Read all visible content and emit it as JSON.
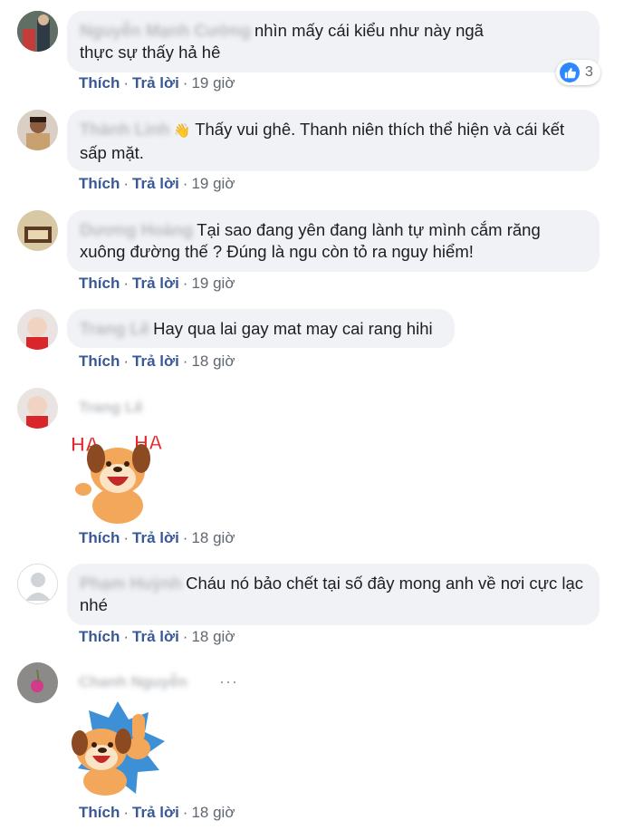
{
  "actions": {
    "like": "Thích",
    "reply": "Trả lời",
    "dot": "·"
  },
  "comments": [
    {
      "author": "Nguyễn Mạnh Cường",
      "text_line1": "nhìn mấy cái kiểu như này ngã",
      "text_line2": "thực sự thấy hả hê",
      "time": "19 giờ",
      "reaction_count": "3"
    },
    {
      "author": "Thành Linh",
      "emoji": "👋",
      "text_line1": "Thấy vui ghê. Thanh niên thích thể hiện và cái kết",
      "text_line2": "sấp mặt.",
      "time": "19 giờ"
    },
    {
      "author": "Dương Hoàng",
      "text_line1": "Tại sao đang yên đang lành tự mình cắm răng",
      "text_line2": "xuông đường thế ? Đúng là ngu còn tỏ ra nguy hiểm!",
      "time": "19 giờ"
    },
    {
      "author": "Trang Lê",
      "text_line1": "Hay qua lai gay mat may cai rang hihi",
      "time": "18 giờ"
    },
    {
      "author": "Trang Lê",
      "sticker_text_1": "HA",
      "sticker_text_2": "HA",
      "sticker": "laughing-dog-sticker",
      "time": "18 giờ"
    },
    {
      "author": "Phạm Huỳnh",
      "text_line1": "Cháu nó bảo chết tại số đây mong anh về nơi cực lạc",
      "text_line2": "nhé",
      "time": "18 giờ"
    },
    {
      "author": "Chanh Nguyễn",
      "sticker": "thumbs-up-dog-sticker",
      "more": "···",
      "time": "18 giờ"
    }
  ],
  "colors": {
    "bubble": "#f0f2f5",
    "link": "#385898",
    "like_blue": "#2d88ff"
  }
}
